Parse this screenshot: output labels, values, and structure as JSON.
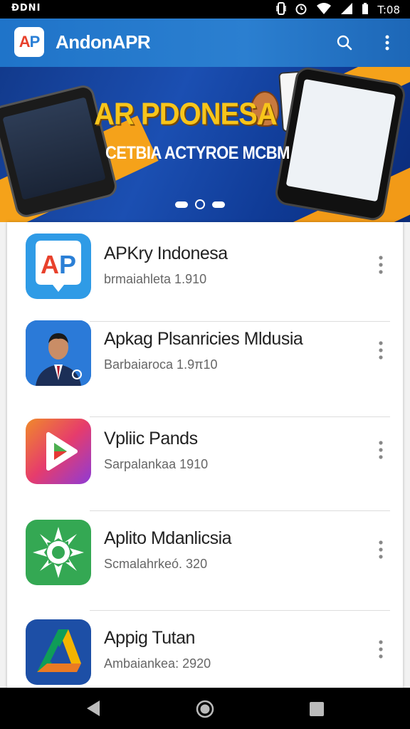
{
  "status_bar": {
    "left_text": "ƉDNI",
    "time": "T:08",
    "icons": [
      "vibrate-icon",
      "alarm-icon",
      "wifi-icon",
      "signal-icon",
      "battery-icon"
    ]
  },
  "app_bar": {
    "title": "AndonAPR",
    "logo": {
      "letter1": "A",
      "letter2": "P"
    },
    "actions": [
      "search-icon",
      "more-vert-icon"
    ]
  },
  "banner": {
    "title": "AR PDONESA",
    "subtitle": "CETBIA ACTYROE MCBM",
    "carousel": {
      "total": 3,
      "active_index": 1
    },
    "colors": {
      "title": "#f7c51b",
      "accent": "#f5a21a",
      "background": "#1b4fb2"
    }
  },
  "apps": [
    {
      "name": "APKry Indonesa",
      "subtitle": "brmaiahleta 1.910",
      "icon": "ap-logo-icon"
    },
    {
      "name": "Apkag Plsanricies Mldusia",
      "subtitle": "Barbaiaroca 1.9π10",
      "icon": "man-portrait-icon"
    },
    {
      "name": "Vpliic Pands",
      "subtitle": "Sarpalankaa 1910",
      "icon": "play-triangle-icon"
    },
    {
      "name": "Aplito Mdanlicsia",
      "subtitle": "Scmalahrkeó. 320",
      "icon": "green-burst-icon"
    },
    {
      "name": "Appig Tutan",
      "subtitle": "Ambaiankea: 2920",
      "icon": "drive-triangle-icon"
    }
  ],
  "nav_bar": [
    "back-icon",
    "home-icon",
    "recents-icon"
  ]
}
